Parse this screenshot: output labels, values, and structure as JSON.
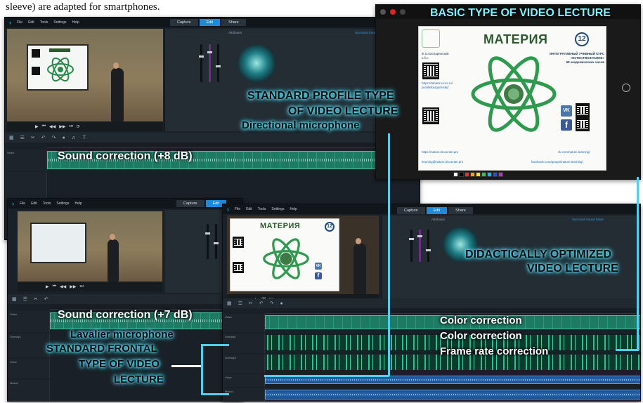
{
  "caption_top": "sleeve) are adapted for smartphones.",
  "editor": {
    "logo_glyph": "›",
    "menu": [
      "File",
      "Edit",
      "Tools",
      "Settings",
      "Help"
    ],
    "modes": [
      "Capture",
      "Edit",
      "Share"
    ],
    "active_mode": "Edit",
    "panel_tab": "Attributes",
    "panel_tab2": "Surround Sound Mixer",
    "timeline_track_labels": [
      "Video",
      "Overlay1",
      "Overlay2",
      "Voice",
      "Music1"
    ]
  },
  "lecture_slide": {
    "title": "МАТЕРИЯ",
    "number": "12",
    "author": "Ф.О.Каспаринский",
    "author_degree": "к.б.н.",
    "course_text": "ИНТЕГРАТИВНЫЙ УЧЕБНЫЙ КУРС «ЕСТЕСТВОЗНАНИЕ»",
    "hours_text": "68 академических часов",
    "link1": "https://nature.biocenter.pro",
    "link2": "learning@nature.biocenter.pro",
    "link3": "vk.com/nature.learning/",
    "link4": "facebook.com/groups/nature.learning/",
    "qr_caption": "https://tabletz.ucoz.ru/ profile/kasparinsky/",
    "vk_glyph": "VK",
    "fb_glyph": "f"
  },
  "labels": {
    "basic": "BASIC TYPE OF VIDEO LECTURE",
    "profile_1": "STANDARD PROFILE TYPE",
    "profile_2": "OF VIDEO LECTURE",
    "directional": "Directional microphone",
    "sound_8": "Sound correction (+8 dB)",
    "sound_7": "Sound correction (+7 dB)",
    "lavalier": "Lavalier microphone",
    "frontal_1": "STANDARD FRONTAL",
    "frontal_2": "TYPE OF VIDEO",
    "frontal_3": "LECTURE",
    "didactic_1": "DIDACTICALLY OPTIMIZED",
    "didactic_2": "VIDEO LECTURE",
    "color_1": "Color correction",
    "color_2": "Color correction",
    "frame_rate": "Frame rate correction"
  },
  "colors": {
    "label_glow": "#63e9ff",
    "accent_blue": "#1f8ad8",
    "audio_green": "#2a9a7c",
    "audio_blue": "#2667b3"
  }
}
